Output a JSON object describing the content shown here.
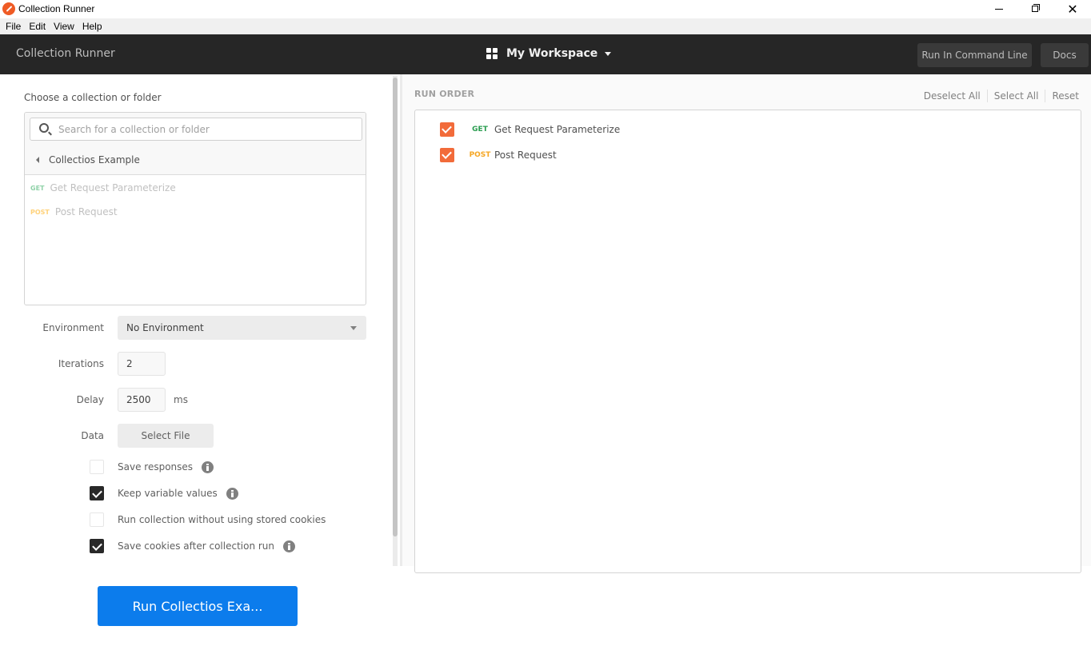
{
  "window": {
    "title": "Collection Runner",
    "close_glyph": "✕"
  },
  "menu": [
    "File",
    "Edit",
    "View",
    "Help"
  ],
  "header": {
    "title": "Collection Runner",
    "workspace": "My Workspace",
    "run_cli_label": "Run In Command Line",
    "docs_label": "Docs"
  },
  "left": {
    "choose_label": "Choose a collection or folder",
    "search_placeholder": "Search for a collection or folder",
    "search_value": "",
    "breadcrumb": "Collectios Example",
    "requests": [
      {
        "method": "GET",
        "name": "Get Request Parameterize"
      },
      {
        "method": "POST",
        "name": "Post Request"
      }
    ],
    "environment_label": "Environment",
    "environment_value": "No Environment",
    "iterations_label": "Iterations",
    "iterations_value": "2",
    "delay_label": "Delay",
    "delay_value": "2500",
    "delay_unit": "ms",
    "data_label": "Data",
    "select_file_label": "Select File",
    "options": [
      {
        "label": "Save responses",
        "checked": false,
        "info": true
      },
      {
        "label": "Keep variable values",
        "checked": true,
        "info": true
      },
      {
        "label": "Run collection without using stored cookies",
        "checked": false,
        "info": false
      },
      {
        "label": "Save cookies after collection run",
        "checked": true,
        "info": true
      }
    ]
  },
  "right": {
    "run_order_label": "RUN ORDER",
    "deselect_all": "Deselect All",
    "select_all": "Select All",
    "reset": "Reset",
    "items": [
      {
        "method": "GET",
        "name": "Get Request Parameterize",
        "checked": true
      },
      {
        "method": "POST",
        "name": "Post Request",
        "checked": true
      }
    ]
  },
  "run_button_label": "Run Collectios Exa...",
  "colors": {
    "accent_orange": "#f26b3a",
    "run_button_blue": "#0c7cec",
    "get_green": "#2a9d50",
    "post_yellow": "#f5a623",
    "header_bg": "#262626"
  }
}
